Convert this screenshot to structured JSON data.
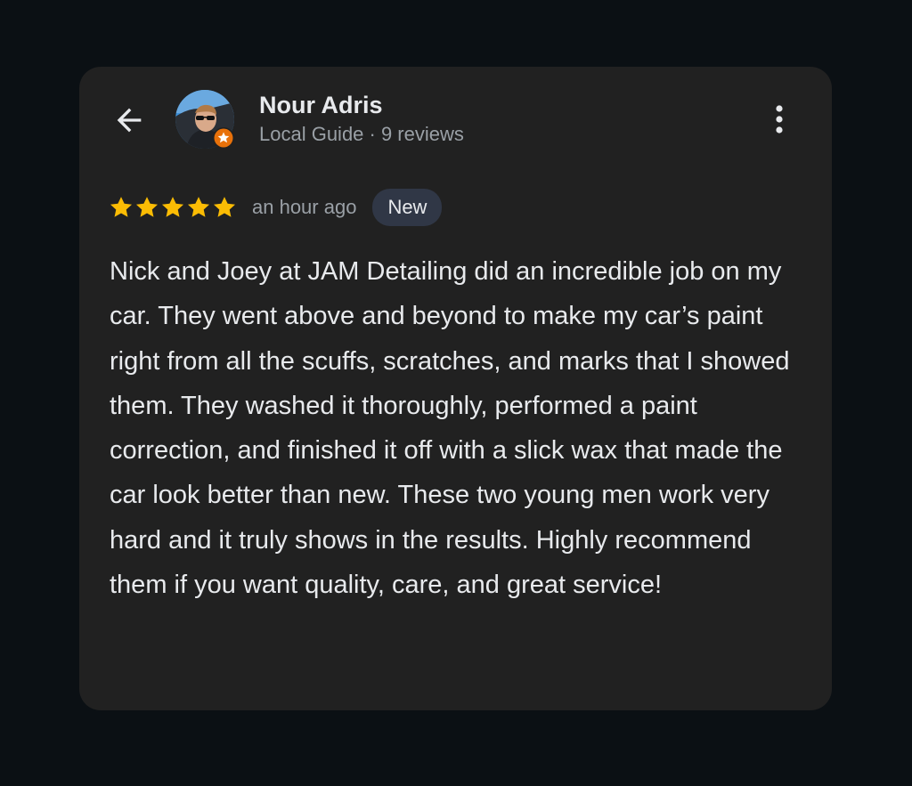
{
  "reviewer": {
    "name": "Nour Adris",
    "subtitle": "Local Guide · 9 reviews",
    "avatar": "profile-photo",
    "badge": "local-guide-star-badge"
  },
  "review": {
    "stars": 5,
    "max_stars": 5,
    "time_ago": "an hour ago",
    "badge_label": "New",
    "text": "Nick and Joey at JAM Detailing did an incredible job on my car. They went above and beyond to make my car’s paint right from all the scuffs, scratches, and marks that I showed them. They washed it thoroughly, performed a paint correction, and finished it off with a slick wax that made the car look better than new. These two young men work very hard and it truly shows in the results. Highly recommend them if you want quality, care, and great service!"
  },
  "icons": {
    "back": "arrow-back-icon",
    "menu": "more-vert-icon",
    "star": "star-icon"
  },
  "colors": {
    "page_background": "#0b1014",
    "card_background": "#212121",
    "star": "#fbbc04",
    "primary_text": "#e8eaed",
    "secondary_text": "#9aa0a6",
    "new_badge_background": "#303746",
    "guide_badge": "#e8710a"
  }
}
